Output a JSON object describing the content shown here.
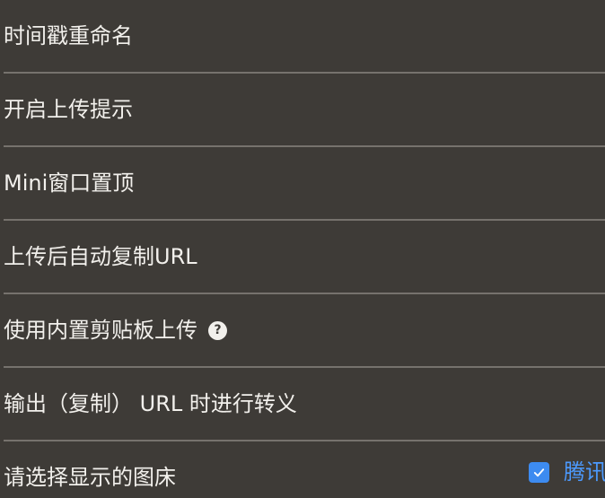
{
  "settings": {
    "items": [
      {
        "label": "时间戳重命名"
      },
      {
        "label": "开启上传提示"
      },
      {
        "label": "Mini窗口置顶"
      },
      {
        "label": "上传后自动复制URL"
      },
      {
        "label": "使用内置剪贴板上传",
        "help_icon": "?"
      },
      {
        "label": "输出（复制） URL 时进行转义"
      },
      {
        "label": "请选择显示的图床"
      }
    ],
    "hosts": [
      {
        "label": "腾讯",
        "checked": true
      }
    ]
  },
  "colors": {
    "background": "#3e3b37",
    "divider": "#76726d",
    "text": "#f2f0ec",
    "accent": "#3d8bf0"
  }
}
